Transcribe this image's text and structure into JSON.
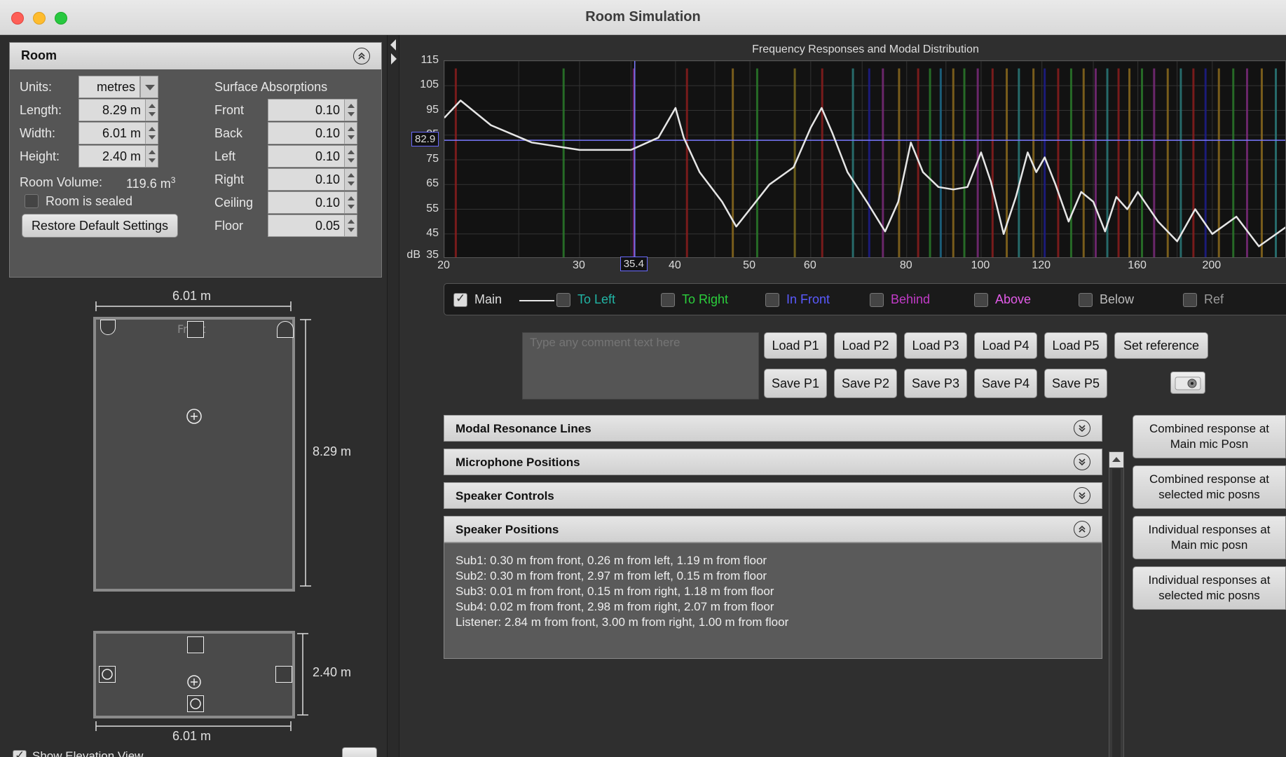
{
  "window": {
    "title": "Room Simulation"
  },
  "room": {
    "header": "Room",
    "units_label": "Units:",
    "units_value": "metres",
    "length_label": "Length:",
    "length_value": "8.29 m",
    "width_label": "Width:",
    "width_value": "6.01 m",
    "height_label": "Height:",
    "height_value": "2.40 m",
    "volume_label": "Room Volume:",
    "volume_value": "119.6 m",
    "volume_unit_sup": "3",
    "sealed_label": "Room is sealed",
    "restore_label": "Restore Default Settings",
    "absorptions_label": "Surface Absorptions",
    "absorptions": [
      {
        "label": "Front",
        "value": "0.10"
      },
      {
        "label": "Back",
        "value": "0.10"
      },
      {
        "label": "Left",
        "value": "0.10"
      },
      {
        "label": "Right",
        "value": "0.10"
      },
      {
        "label": "Ceiling",
        "value": "0.10"
      },
      {
        "label": "Floor",
        "value": "0.05"
      }
    ]
  },
  "plan": {
    "top_width": "6.01 m",
    "side_length": "8.29 m",
    "front_label": "Front",
    "elev_height": "2.40 m",
    "elev_width": "6.01 m",
    "show_elevation": "Show Elevation View"
  },
  "chart": {
    "title": "Frequency Responses and Modal Distribution",
    "y_unit": "dB",
    "y_ticks": [
      "115",
      "105",
      "95",
      "85",
      "75",
      "65",
      "55",
      "45",
      "35"
    ],
    "x_ticks": [
      "20",
      "30",
      "40",
      "50",
      "60",
      "80",
      "100",
      "120",
      "160",
      "200"
    ],
    "cursor_x": "35.4",
    "cursor_y": "82.9"
  },
  "chart_data": {
    "type": "line",
    "title": "Frequency Responses and Modal Distribution",
    "xlabel": "",
    "ylabel": "dB",
    "xscale": "log",
    "xlim": [
      20,
      250
    ],
    "ylim": [
      35,
      115
    ],
    "grid": true,
    "series": [
      {
        "name": "Main",
        "x": [
          20,
          21,
          23,
          26,
          30,
          35,
          38,
          40,
          41,
          43,
          46,
          48,
          50,
          53,
          57,
          60,
          62,
          64,
          67,
          71,
          75,
          78,
          81,
          84,
          88,
          92,
          96,
          100,
          103,
          107,
          111,
          115,
          118,
          121,
          125,
          130,
          135,
          140,
          145,
          150,
          155,
          160,
          170,
          180,
          190,
          200,
          215,
          230,
          250
        ],
        "y": [
          92,
          99,
          89,
          82,
          79,
          79,
          84,
          96,
          84,
          70,
          58,
          48,
          55,
          65,
          72,
          88,
          96,
          86,
          70,
          58,
          46,
          58,
          82,
          70,
          64,
          63,
          64,
          78,
          66,
          45,
          60,
          78,
          70,
          76,
          65,
          50,
          62,
          58,
          46,
          60,
          55,
          62,
          50,
          42,
          55,
          45,
          52,
          40,
          48
        ]
      }
    ],
    "mode_lines": [
      {
        "freq": 20.7,
        "color": "#8a1d1d"
      },
      {
        "freq": 28.6,
        "color": "#2a7a2a"
      },
      {
        "freq": 35.3,
        "color": "#7a2a7a"
      },
      {
        "freq": 41.4,
        "color": "#8a1d1d"
      },
      {
        "freq": 47.5,
        "color": "#8a6a1d"
      },
      {
        "freq": 51.1,
        "color": "#2a7a2a"
      },
      {
        "freq": 57.2,
        "color": "#7a6a1d"
      },
      {
        "freq": 62.1,
        "color": "#8a1d1d"
      },
      {
        "freq": 68.1,
        "color": "#2a7a7a"
      },
      {
        "freq": 71.5,
        "color": "#1d1d8a"
      },
      {
        "freq": 74.5,
        "color": "#7a2a7a"
      },
      {
        "freq": 78.2,
        "color": "#8a6a1d"
      },
      {
        "freq": 82.8,
        "color": "#8a1d1d"
      },
      {
        "freq": 85.8,
        "color": "#2a7a2a"
      },
      {
        "freq": 88.6,
        "color": "#1d6a8a"
      },
      {
        "freq": 92.0,
        "color": "#8a6a1d"
      },
      {
        "freq": 95.1,
        "color": "#2a7a2a"
      },
      {
        "freq": 99.0,
        "color": "#7a2a7a"
      },
      {
        "freq": 103.5,
        "color": "#8a1d1d"
      },
      {
        "freq": 108.0,
        "color": "#8a6a1d"
      },
      {
        "freq": 112.0,
        "color": "#2a7a7a"
      },
      {
        "freq": 117.0,
        "color": "#8a6a1d"
      },
      {
        "freq": 121.0,
        "color": "#1d1d8a"
      },
      {
        "freq": 126.0,
        "color": "#8a1d1d"
      },
      {
        "freq": 131.0,
        "color": "#2a7a2a"
      },
      {
        "freq": 136.0,
        "color": "#8a6a1d"
      },
      {
        "freq": 141.0,
        "color": "#7a2a7a"
      },
      {
        "freq": 146.0,
        "color": "#2a7a7a"
      },
      {
        "freq": 151.0,
        "color": "#8a1d1d"
      },
      {
        "freq": 156.0,
        "color": "#8a6a1d"
      },
      {
        "freq": 162.0,
        "color": "#2a7a2a"
      },
      {
        "freq": 168.0,
        "color": "#7a2a7a"
      },
      {
        "freq": 175.0,
        "color": "#8a6a1d"
      },
      {
        "freq": 182.0,
        "color": "#2a7a7a"
      },
      {
        "freq": 189.0,
        "color": "#8a1d1d"
      },
      {
        "freq": 196.0,
        "color": "#1d1d8a"
      },
      {
        "freq": 204.0,
        "color": "#8a6a1d"
      },
      {
        "freq": 213.0,
        "color": "#2a7a2a"
      },
      {
        "freq": 222.0,
        "color": "#7a2a7a"
      },
      {
        "freq": 232.0,
        "color": "#8a6a1d"
      },
      {
        "freq": 242.0,
        "color": "#2a7a7a"
      }
    ]
  },
  "legend": [
    {
      "label": "Main",
      "checked": true,
      "color": "#e6e6e6"
    },
    {
      "label": "To Left",
      "checked": false,
      "color": "#21b5a5"
    },
    {
      "label": "To Right",
      "checked": false,
      "color": "#2bcf3c"
    },
    {
      "label": "In Front",
      "checked": false,
      "color": "#5a5aff"
    },
    {
      "label": "Behind",
      "checked": false,
      "color": "#c23bc8"
    },
    {
      "label": "Above",
      "checked": false,
      "color": "#e25be8"
    },
    {
      "label": "Below",
      "checked": false,
      "color": "#bdbdbd"
    },
    {
      "label": "Ref",
      "checked": false,
      "color": "#9a9a9a"
    }
  ],
  "comment_placeholder": "Type any comment text here",
  "load_buttons": [
    "Load P1",
    "Load P2",
    "Load P3",
    "Load P4",
    "Load P5"
  ],
  "save_buttons": [
    "Save P1",
    "Save P2",
    "Save P3",
    "Save P4",
    "Save P5"
  ],
  "set_reference": "Set reference",
  "accordions": {
    "modal": "Modal Resonance Lines",
    "mic": "Microphone Positions",
    "speaker_controls": "Speaker Controls",
    "speaker_positions": "Speaker Positions"
  },
  "speaker_positions": [
    "Sub1: 0.30 m from front, 0.26 m from left, 1.19 m from floor",
    "Sub2: 0.30 m from front, 2.97 m from left, 0.15 m from floor",
    "Sub3: 0.01 m from front, 0.15 m from right, 1.18 m from floor",
    "Sub4: 0.02 m from front, 2.98 m from right, 2.07 m from floor",
    "Listener: 2.84 m from front, 3.00 m from right, 1.00 m from floor"
  ],
  "side_buttons": [
    "Combined response at Main mic Posn",
    "Combined response at selected mic posns",
    "Individual responses at Main mic posn",
    "Individual responses at selected mic posns"
  ]
}
